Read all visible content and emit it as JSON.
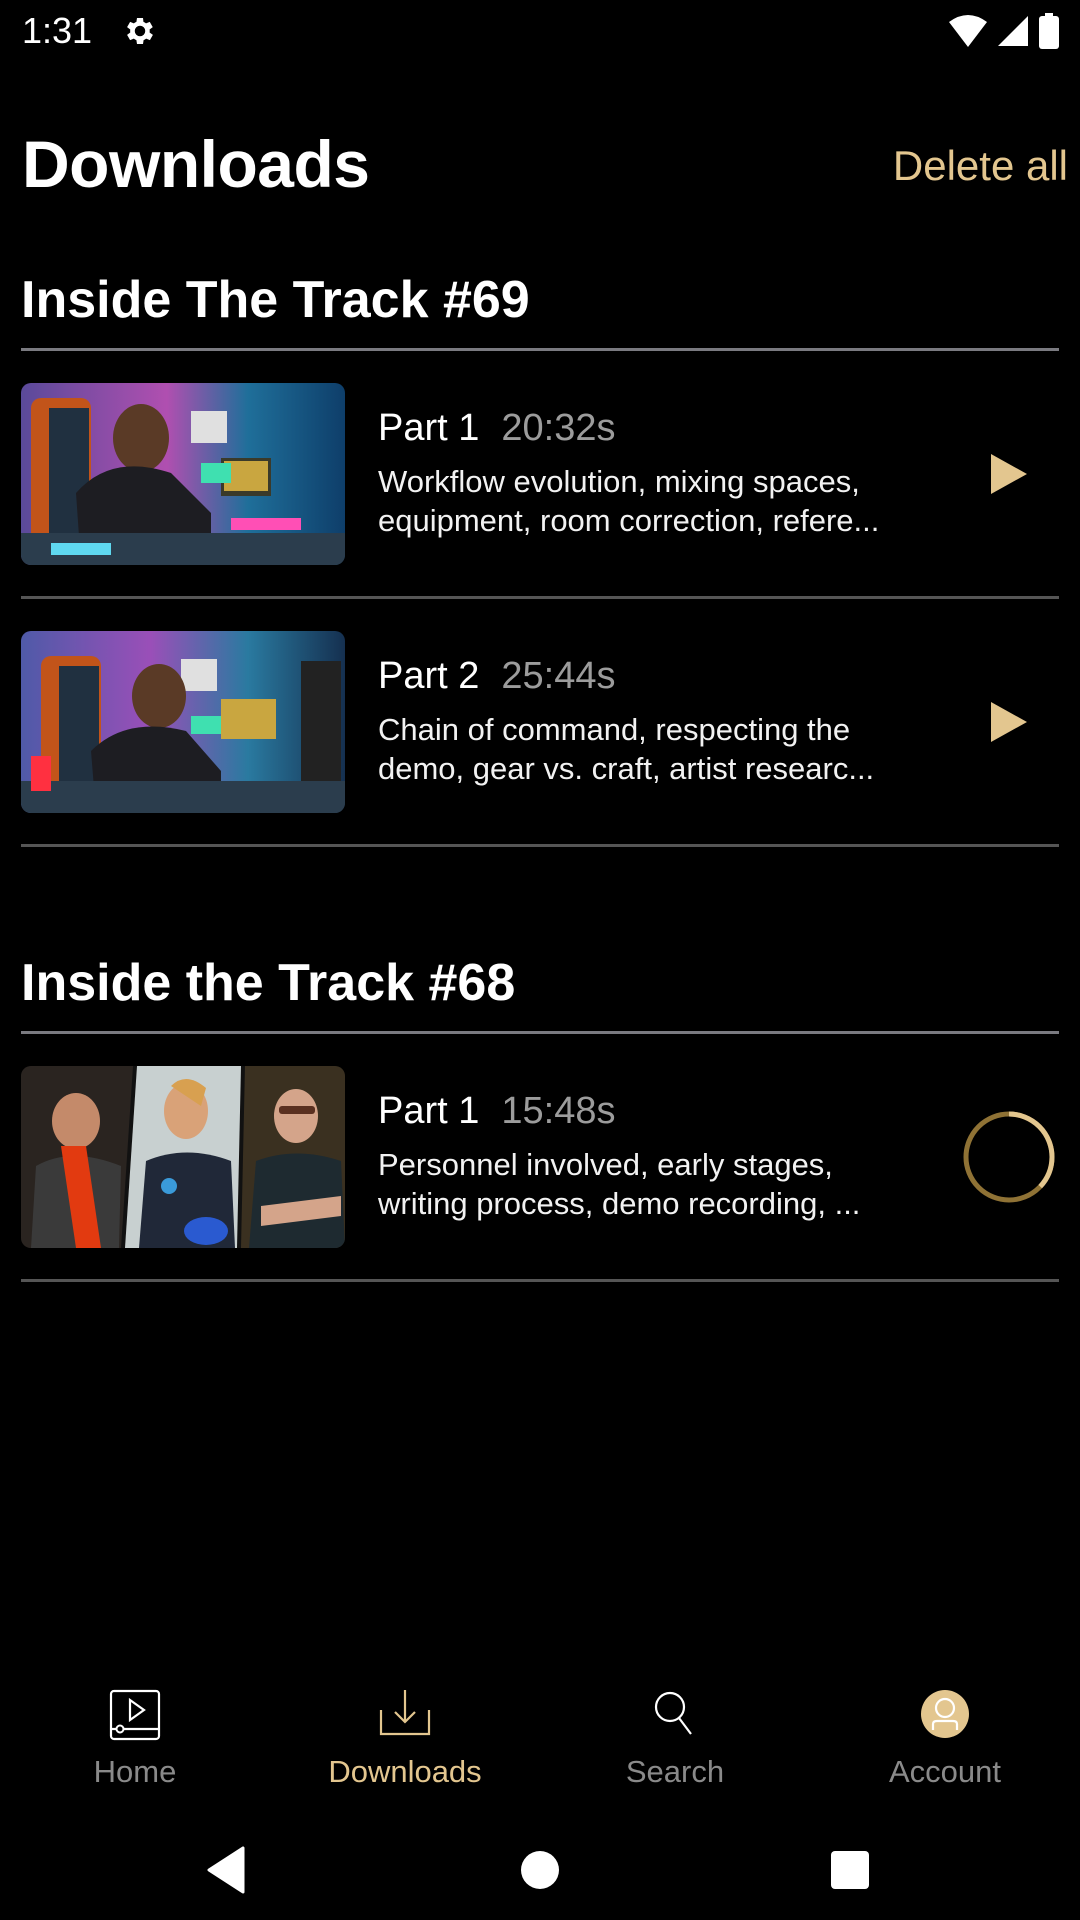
{
  "status_bar": {
    "time": "1:31",
    "icons": [
      "gear-icon",
      "wifi-icon",
      "signal-icon",
      "battery-icon"
    ]
  },
  "header": {
    "title": "Downloads",
    "delete_all_label": "Delete all"
  },
  "colors": {
    "accent": "#e3c68f",
    "background": "#000000",
    "divider": "#555555",
    "muted_text": "#9c9c9c"
  },
  "sections": [
    {
      "title": "Inside The Track #69",
      "episodes": [
        {
          "part": "Part 1",
          "duration": "20:32s",
          "description": "Workflow evolution, mixing spaces,\nequipment, room correction, refere...",
          "thumbnail": "man in studio with purple and teal lighting at mixing desk",
          "action": "play-icon"
        },
        {
          "part": "Part 2",
          "duration": "25:44s",
          "description": "Chain of command, respecting the\ndemo, gear vs. craft, artist researc...",
          "thumbnail": "man in studio with purple and teal lighting at mixing desk",
          "action": "play-icon"
        }
      ]
    },
    {
      "title": "Inside the Track #68",
      "episodes": [
        {
          "part": "Part 1",
          "duration": "15:48s",
          "description": "Personnel involved, early stages,\nwriting process, demo recording, ...",
          "thumbnail": "three-panel collage of three men being interviewed",
          "action": "download-progress-ring",
          "download_progress": 0.37
        }
      ]
    }
  ],
  "bottom_nav": {
    "items": [
      {
        "label": "Home",
        "icon": "video-player-icon",
        "active": false
      },
      {
        "label": "Downloads",
        "icon": "download-icon",
        "active": true
      },
      {
        "label": "Search",
        "icon": "search-icon",
        "active": false
      },
      {
        "label": "Account",
        "icon": "account-icon",
        "active": false
      }
    ]
  },
  "system_nav": [
    "back-icon",
    "home-icon",
    "recents-icon"
  ]
}
